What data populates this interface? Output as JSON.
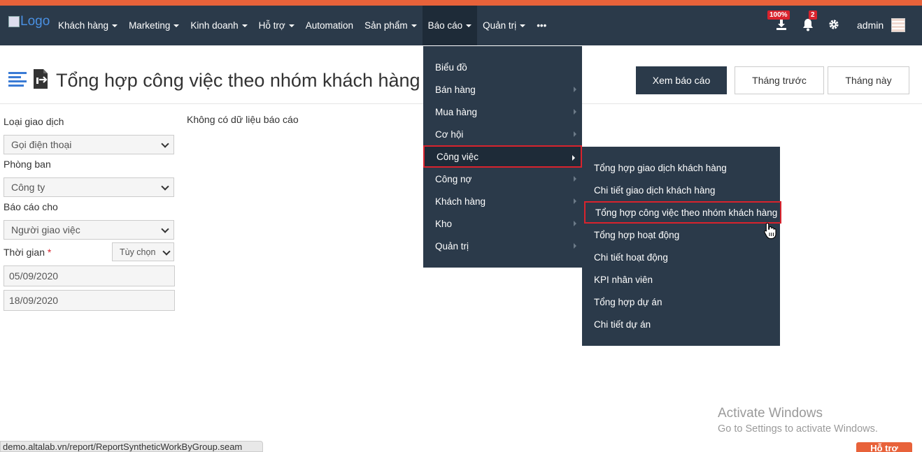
{
  "nav": {
    "logo_alt": "Logo",
    "items": [
      {
        "label": "Khách hàng",
        "caret": true
      },
      {
        "label": "Marketing",
        "caret": true
      },
      {
        "label": "Kinh doanh",
        "caret": true
      },
      {
        "label": "Hỗ trợ",
        "caret": true
      },
      {
        "label": "Automation",
        "caret": false
      },
      {
        "label": "Sản phẩm",
        "caret": true
      },
      {
        "label": "Báo cáo",
        "caret": true
      },
      {
        "label": "Quản trị",
        "caret": true
      },
      {
        "label": "•••",
        "caret": false
      }
    ],
    "download_badge": "100%",
    "notif_badge": "2",
    "user": "admin"
  },
  "page": {
    "title": "Tổng hợp công việc theo nhóm khách hàng",
    "buttons": {
      "view": "Xem báo cáo",
      "prev_month": "Tháng trước",
      "this_month": "Tháng này"
    },
    "no_data": "Không có dữ liệu báo cáo"
  },
  "filters": {
    "transaction_type_label": "Loại giao dịch",
    "transaction_type_value": "Gọi điện thoại",
    "department_label": "Phòng ban",
    "department_value": "Công ty",
    "report_for_label": "Báo cáo cho",
    "report_for_value": "Người giao việc",
    "time_label": "Thời gian",
    "time_required": "*",
    "time_option": "Tùy chọn",
    "from_date": "05/09/2020",
    "to_date": "18/09/2020"
  },
  "report_menu": {
    "items": [
      {
        "label": "Biểu đồ",
        "arrow": false
      },
      {
        "label": "Bán hàng",
        "arrow": true
      },
      {
        "label": "Mua hàng",
        "arrow": true
      },
      {
        "label": "Cơ hội",
        "arrow": true
      },
      {
        "label": "Công việc",
        "arrow": true
      },
      {
        "label": "Công nợ",
        "arrow": true
      },
      {
        "label": "Khách hàng",
        "arrow": true
      },
      {
        "label": "Kho",
        "arrow": true
      },
      {
        "label": "Quản trị",
        "arrow": true
      }
    ],
    "highlighted_index": 4
  },
  "work_submenu": {
    "items": [
      "Tổng hợp giao dịch khách hàng",
      "Chi tiết giao dịch khách hàng",
      "Tổng hợp công việc theo nhóm khách hàng",
      "Tổng hợp hoạt động",
      "Chi tiết hoạt động",
      "KPI nhân viên",
      "Tổng hợp dự án",
      "Chi tiết dự án"
    ],
    "highlighted_index": 2
  },
  "overlay": {
    "activate_title": "Activate Windows",
    "activate_sub": "Go to Settings to activate Windows.",
    "status_url": "demo.altalab.vn/report/ReportSyntheticWorkByGroup.seam",
    "help_label": "Hỗ trợ"
  },
  "colors": {
    "navbar": "#2b3a4a",
    "accent": "#e8623a",
    "highlight_border": "#d9232d"
  }
}
